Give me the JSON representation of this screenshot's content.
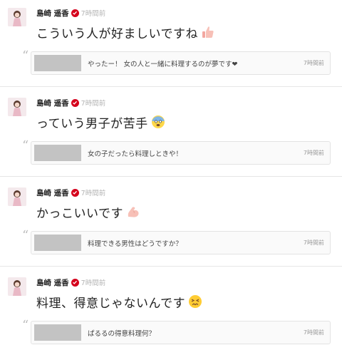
{
  "posts": [
    {
      "author": "島崎 遥香",
      "time": "7時間前",
      "message": "こういう人が好ましいですね",
      "emoji": "thumbs-up",
      "reply": {
        "text": "やったー！ 女の人と一緒に料理するのが夢です❤",
        "time": "7時間前"
      }
    },
    {
      "author": "島崎 遥香",
      "time": "7時間前",
      "message": "っていう男子が苦手",
      "emoji": "fearful-face",
      "reply": {
        "text": "女の子だったら料理しときや！",
        "time": "7時間前"
      }
    },
    {
      "author": "島崎 遥香",
      "time": "7時間前",
      "message": "かっこいいです",
      "emoji": "flexed-biceps",
      "reply": {
        "text": "料理できる男性はどうですか？",
        "time": "7時間前"
      }
    },
    {
      "author": "島崎 遥香",
      "time": "7時間前",
      "message": "料理、得意じゃないんです",
      "emoji": "confounded-face",
      "reply": {
        "text": "ぱるるの得意料理何？",
        "time": "7時間前"
      }
    }
  ],
  "colors": {
    "verified": "#d5001c",
    "time": "#b3b3b3",
    "reply_border": "#e3e3e3",
    "reply_placeholder": "#c3c3c3"
  }
}
